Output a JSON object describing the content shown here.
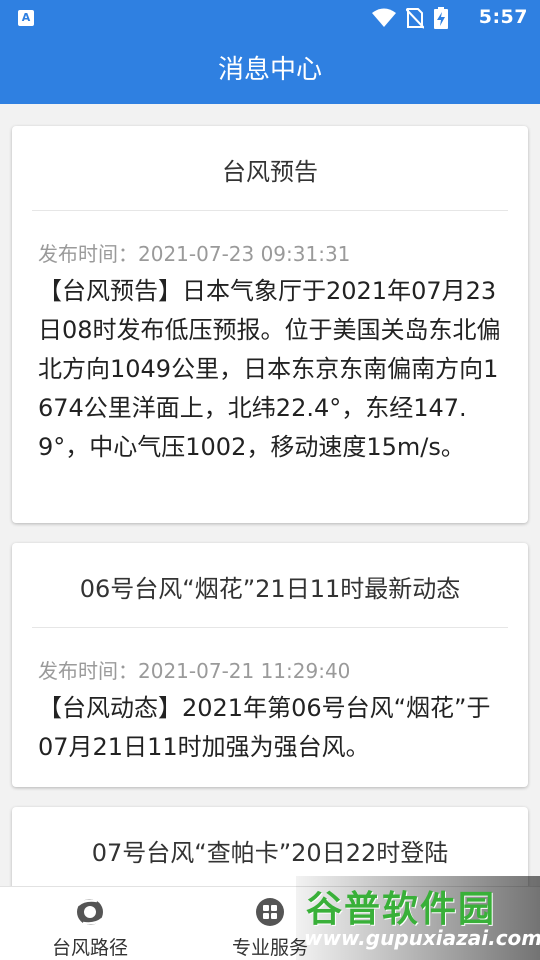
{
  "status_bar": {
    "time": "5:57",
    "left_icon_letter": "A",
    "icons": [
      "wifi-icon",
      "no-sim-icon",
      "battery-charging-icon"
    ]
  },
  "app_bar": {
    "title": "消息中心"
  },
  "messages": [
    {
      "title": "台风预告",
      "time": "发布时间：2021-07-23 09:31:31",
      "body": "【台风预告】日本气象厅于2021年07月23日08时发布低压预报。位于美国关岛东北偏北方向1049公里，日本东京东南偏南方向1674公里洋面上，北纬22.4°，东经147.9°，中心气压1002，移动速度15m/s。"
    },
    {
      "title": "06号台风“烟花”21日11时最新动态",
      "time": "发布时间：2021-07-21 11:29:40",
      "body": "【台风动态】2021年第06号台风“烟花”于07月21日11时加强为强台风。"
    },
    {
      "title": "07号台风“查帕卡”20日22时登陆",
      "time": "",
      "body": ""
    }
  ],
  "bottom_nav": {
    "items": [
      {
        "label": "台风路径",
        "icon": "typhoon-icon"
      },
      {
        "label": "专业服务",
        "icon": "grid-icon"
      }
    ]
  },
  "watermark": {
    "logo": "谷普软件园",
    "url": "www.gupuxiazai.com"
  },
  "colors": {
    "primary": "#2f80e1",
    "background": "#f2f2f2",
    "time_text": "#9a9a9a"
  }
}
